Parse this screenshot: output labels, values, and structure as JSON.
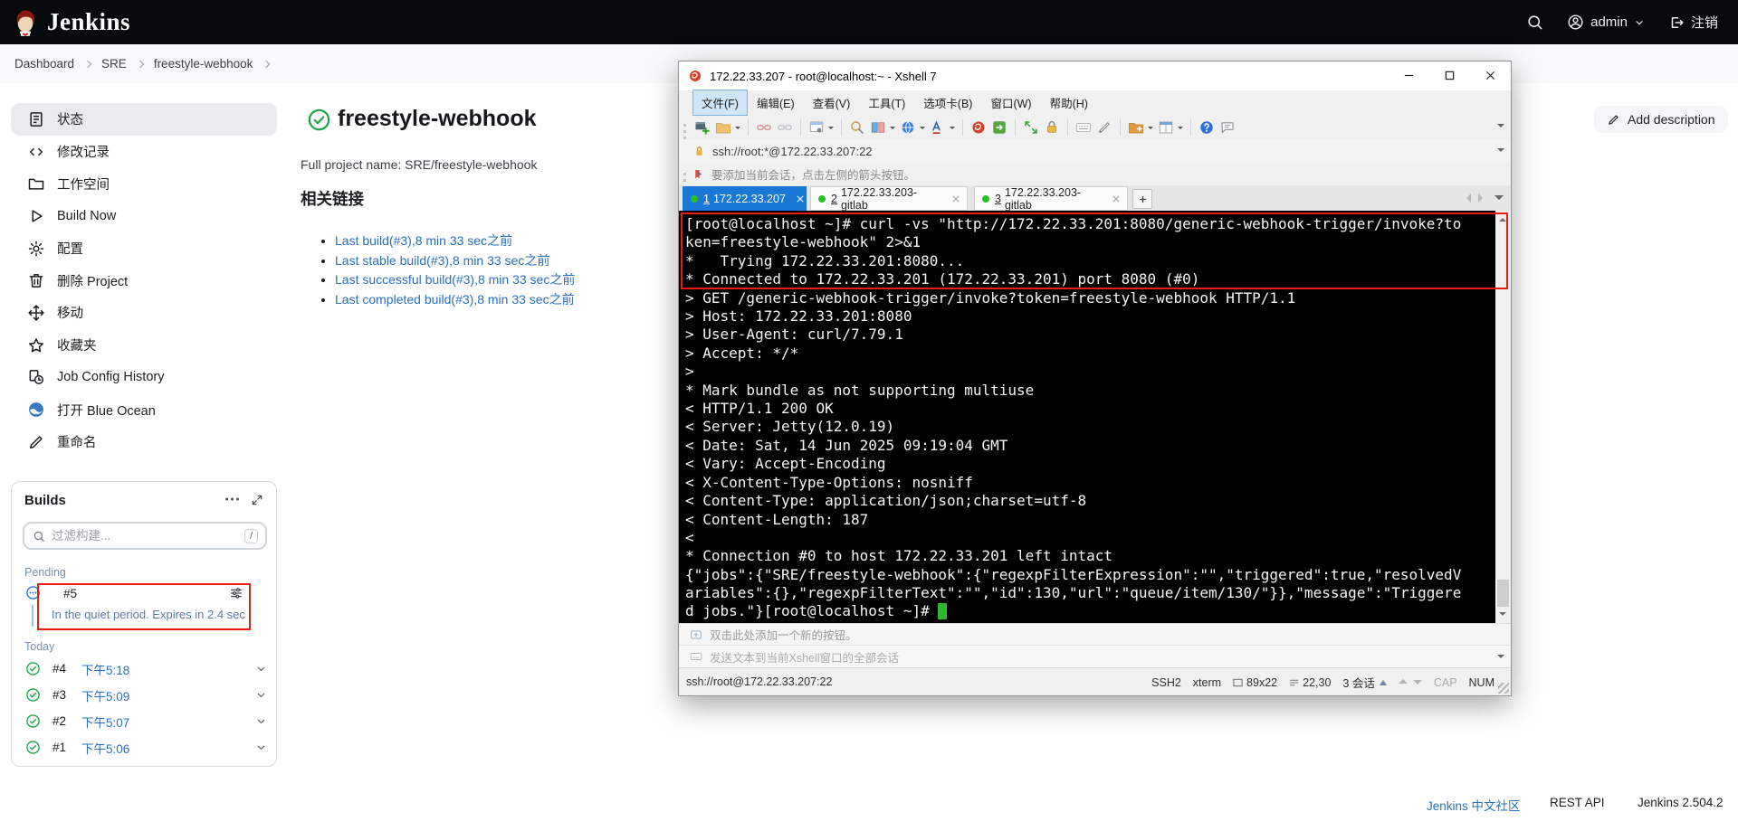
{
  "header": {
    "brand": "Jenkins",
    "user_name": "admin",
    "logout_label": "注销"
  },
  "breadcrumb": {
    "items": [
      "Dashboard",
      "SRE",
      "freestyle-webhook"
    ]
  },
  "sidebar": {
    "items": [
      {
        "label": "状态"
      },
      {
        "label": "修改记录"
      },
      {
        "label": "工作空间"
      },
      {
        "label": "Build Now"
      },
      {
        "label": "配置"
      },
      {
        "label": "删除 Project"
      },
      {
        "label": "移动"
      },
      {
        "label": "收藏夹"
      },
      {
        "label": "Job Config History"
      },
      {
        "label": "打开 Blue Ocean"
      },
      {
        "label": "重命名"
      }
    ]
  },
  "builds": {
    "title": "Builds",
    "filter_placeholder": "过滤构建...",
    "shortcut_key": "/",
    "pending_label": "Pending",
    "today_label": "Today",
    "pending_item": {
      "number": "#5",
      "note": "In the quiet period. Expires in 2.4 sec"
    },
    "items": [
      {
        "number": "#4",
        "time": "下午5:18"
      },
      {
        "number": "#3",
        "time": "下午5:09"
      },
      {
        "number": "#2",
        "time": "下午5:07"
      },
      {
        "number": "#1",
        "time": "下午5:06"
      }
    ]
  },
  "main": {
    "job_title": "freestyle-webhook",
    "full_project_name": "Full project name: SRE/freestyle-webhook",
    "links_heading": "相关链接",
    "links": [
      "Last build(#3),8 min 33 sec之前",
      "Last stable build(#3),8 min 33 sec之前",
      "Last successful build(#3),8 min 33 sec之前",
      "Last completed build(#3),8 min 33 sec之前"
    ],
    "add_description": "Add description"
  },
  "xshell": {
    "window_title": "172.22.33.207 - root@localhost:~ - Xshell 7",
    "menu": [
      "文件(F)",
      "编辑(E)",
      "查看(V)",
      "工具(T)",
      "选项卡(B)",
      "窗口(W)",
      "帮助(H)"
    ],
    "address": "ssh://root:*@172.22.33.207:22",
    "session_hint": "要添加当前会话，点击左侧的箭头按钮。",
    "tabs": [
      {
        "num": "1",
        "host": "172.22.33.207"
      },
      {
        "num": "2",
        "host": "172.22.33.203-gitlab"
      },
      {
        "num": "3",
        "host": "172.22.33.203-gitlab"
      }
    ],
    "terminal": {
      "text": "[root@localhost ~]# curl -vs \"http://172.22.33.201:8080/generic-webhook-trigger/invoke?to\nken=freestyle-webhook\" 2>&1\n*   Trying 172.22.33.201:8080...\n* Connected to 172.22.33.201 (172.22.33.201) port 8080 (#0)\n> GET /generic-webhook-trigger/invoke?token=freestyle-webhook HTTP/1.1\n> Host: 172.22.33.201:8080\n> User-Agent: curl/7.79.1\n> Accept: */*\n>\n* Mark bundle as not supporting multiuse\n< HTTP/1.1 200 OK\n< Server: Jetty(12.0.19)\n< Date: Sat, 14 Jun 2025 09:19:04 GMT\n< Vary: Accept-Encoding\n< X-Content-Type-Options: nosniff\n< Content-Type: application/json;charset=utf-8\n< Content-Length: 187\n<\n* Connection #0 to host 172.22.33.201 left intact\n{\"jobs\":{\"SRE/freestyle-webhook\":{\"regexpFilterExpression\":\"\",\"triggered\":true,\"resolvedV\nariables\":{},\"regexpFilterText\":\"\",\"id\":130,\"url\":\"queue/item/130/\"}},\"message\":\"Triggere",
      "last_line": "d jobs.\"}[root@localhost ~]# "
    },
    "quick_bar_hint": "双击此处添加一个新的按钮。",
    "send_bar_hint": "发送文本到当前Xshell窗口的全部会话",
    "status": {
      "address": "ssh://root@172.22.33.207:22",
      "protocol": "SSH2",
      "terminal_type": "xterm",
      "size": "89x22",
      "cursor_pos": "22,30",
      "sessions": "3 会话",
      "cap": "CAP",
      "num": "NUM"
    }
  },
  "footer": {
    "community_link": "Jenkins 中文社区",
    "rest_api": "REST API",
    "version": "Jenkins 2.504.2"
  },
  "colors": {
    "header_bg": "#070a0c",
    "annotation_red": "#e81c12",
    "link_blue": "#2a6fc4",
    "success_green": "#23a550",
    "pending_blue": "#2f6fd6",
    "active_tab_blue": "#1a79d7",
    "terminal_cursor_green": "#2eb82e"
  }
}
